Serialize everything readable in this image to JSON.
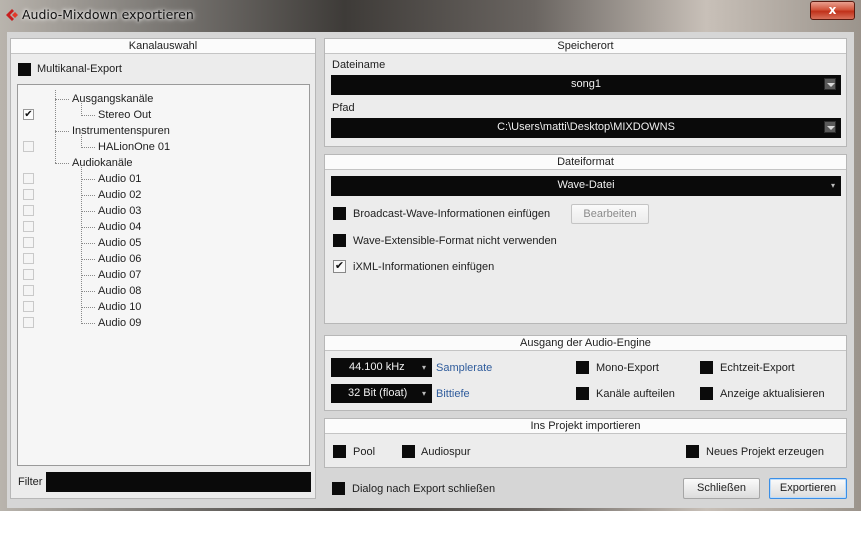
{
  "window": {
    "title": "Audio-Mixdown exportieren",
    "close_label": "x"
  },
  "kanalauswahl": {
    "header": "Kanalauswahl",
    "multichannel_label": "Multikanal-Export",
    "tree": {
      "outputs_group": "Ausgangskanäle",
      "stereo_out": "Stereo Out",
      "instruments_group": "Instrumentenspuren",
      "halion": "HALionOne 01",
      "audio_group": "Audiokanäle",
      "audio_channels": [
        "Audio 01",
        "Audio 02",
        "Audio 03",
        "Audio 04",
        "Audio 05",
        "Audio 06",
        "Audio 07",
        "Audio 08",
        "Audio 10",
        "Audio 09"
      ]
    },
    "filter_label": "Filter",
    "filter_value": ""
  },
  "speicherort": {
    "header": "Speicherort",
    "filename_label": "Dateiname",
    "filename_value": "song1",
    "path_label": "Pfad",
    "path_value": "C:\\Users\\matti\\Desktop\\MIXDOWNS"
  },
  "dateiformat": {
    "header": "Dateiformat",
    "format_value": "Wave-Datei",
    "bwf_label": "Broadcast-Wave-Informationen einfügen",
    "edit_button": "Bearbeiten",
    "wavext_label": "Wave-Extensible-Format nicht verwenden",
    "ixml_label": "iXML-Informationen einfügen"
  },
  "engine": {
    "header": "Ausgang der Audio-Engine",
    "samplerate_value": "44.100 kHz",
    "samplerate_label": "Samplerate",
    "bitdepth_value": "32 Bit (float)",
    "bitdepth_label": "Bittiefe",
    "mono_label": "Mono-Export",
    "split_label": "Kanäle aufteilen",
    "realtime_label": "Echtzeit-Export",
    "update_label": "Anzeige aktualisieren"
  },
  "import": {
    "header": "Ins Projekt importieren",
    "pool_label": "Pool",
    "audiotrack_label": "Audiospur",
    "newproject_label": "Neues Projekt erzeugen"
  },
  "footer": {
    "close_after_label": "Dialog nach Export schließen",
    "close_button": "Schließen",
    "export_button": "Exportieren"
  }
}
